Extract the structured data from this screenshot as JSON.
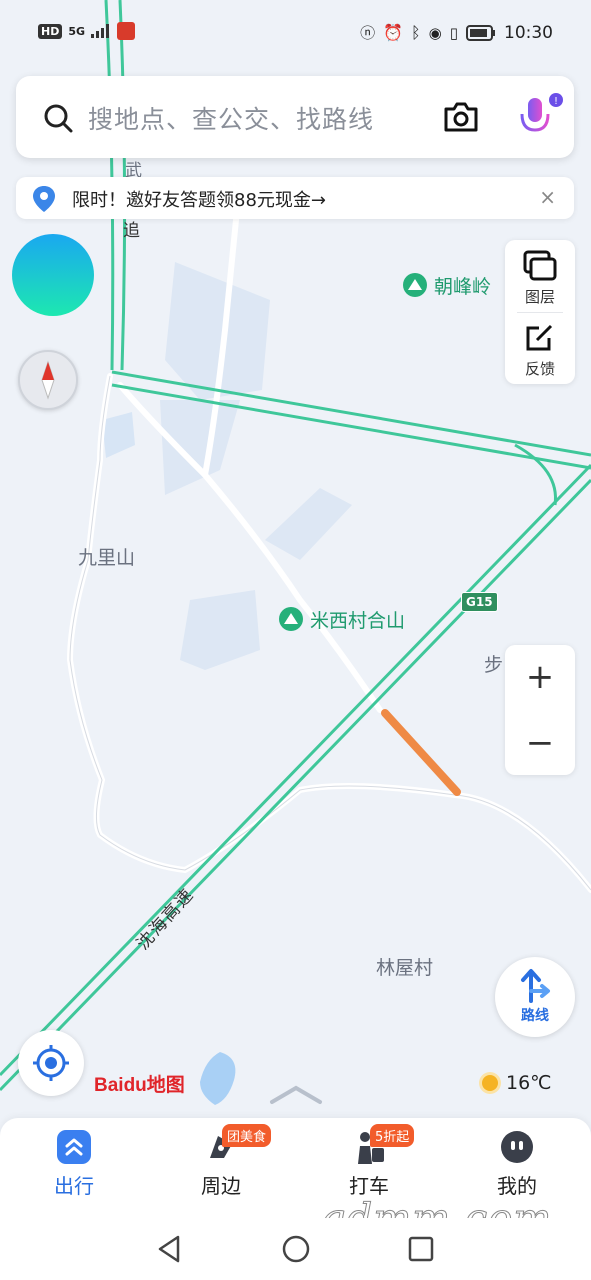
{
  "status_bar": {
    "hd": "HD",
    "network": "5G",
    "time": "10:30"
  },
  "search": {
    "placeholder": "搜地点、查公交、找路线",
    "icons": [
      "search-icon",
      "camera-icon",
      "microphone-icon"
    ]
  },
  "promo": {
    "text": "限时！邀好友答题领88元现金→",
    "close": "×"
  },
  "layers": {
    "layer_label": "图层",
    "feedback_label": "反馈"
  },
  "zoom": {
    "plus": "+",
    "minus": "−"
  },
  "route_button": {
    "label": "路线"
  },
  "map_labels": {
    "place_jiulishan": "九里山",
    "place_linwucun": "林屋村",
    "place_bu": "步",
    "poi_chaofengling": "朝峰岭",
    "poi_mixicunheshan": "米西村合山",
    "road_shield": "G15",
    "road_name_vertical": "沈海高速",
    "road_top_fragment_1": "武",
    "road_top_fragment_2": "追"
  },
  "logo": {
    "text": "Baidu地图"
  },
  "weather": {
    "temperature": "16℃"
  },
  "tabs": [
    {
      "label": "出行",
      "active": true
    },
    {
      "label": "周边",
      "badge": "团美食"
    },
    {
      "label": "打车",
      "badge": "5折起"
    },
    {
      "label": "我的"
    }
  ],
  "watermark": "gdmm.com",
  "colors": {
    "highway": "#3fc79a",
    "accent": "#2a6fe0",
    "congestion": "#ef8a45",
    "badge": "#f25c2b"
  }
}
